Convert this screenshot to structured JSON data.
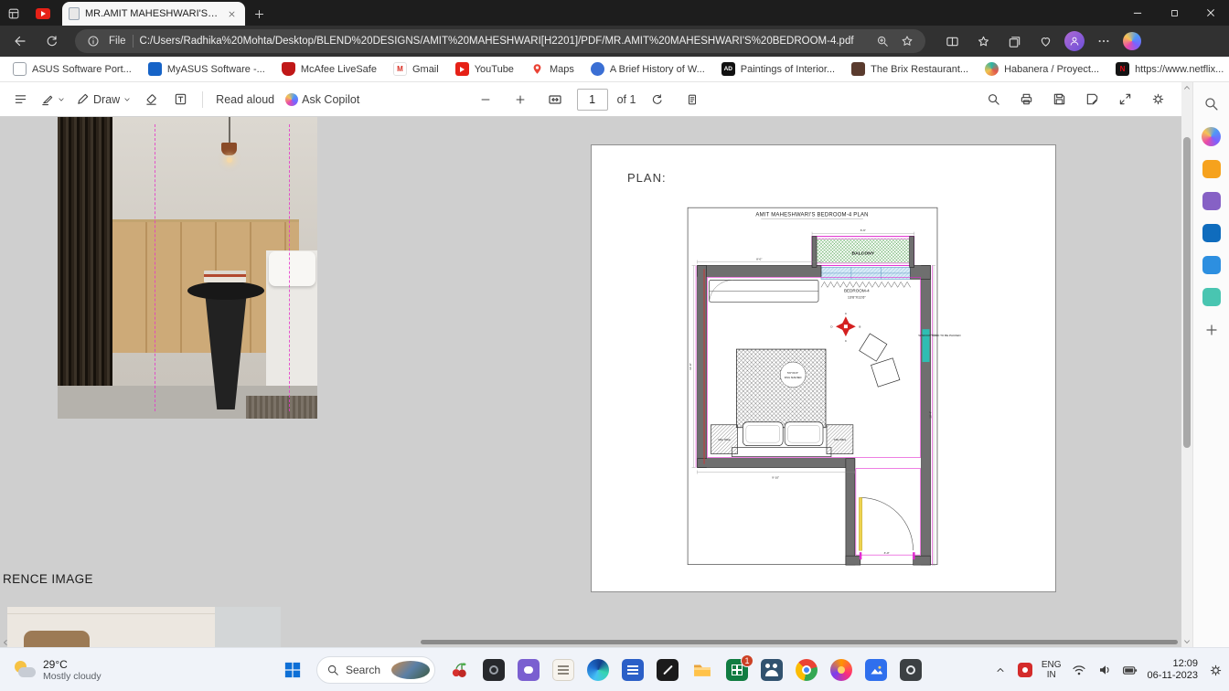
{
  "browser": {
    "tab_title": "MR.AMIT MAHESHWARI'S BEDR...",
    "file_label": "File",
    "url": "C:/Users/Radhika%20Mohta/Desktop/BLEND%20DESIGNS/AMIT%20MAHESHWARI[H2201]/PDF/MR.AMIT%20MAHESHWARI'S%20BEDROOM-4.pdf",
    "bookmarks": [
      {
        "label": "ASUS Software Port..."
      },
      {
        "label": "MyASUS Software -..."
      },
      {
        "label": "McAfee LiveSafe"
      },
      {
        "label": "Gmail",
        "glyph": "M"
      },
      {
        "label": "YouTube"
      },
      {
        "label": "Maps"
      },
      {
        "label": "A Brief History of W..."
      },
      {
        "label": "Paintings of Interior...",
        "glyph": "AD"
      },
      {
        "label": "The Brix Restaurant..."
      },
      {
        "label": "Habanera / Proyect..."
      },
      {
        "label": "https://www.netflix...",
        "glyph": "N"
      }
    ]
  },
  "pdf_toolbar": {
    "draw_label": "Draw",
    "read_aloud_label": "Read aloud",
    "ask_copilot_label": "Ask Copilot",
    "page_value": "1",
    "page_total_label": "of 1"
  },
  "document": {
    "reference_caption": "RENCE IMAGE",
    "plan_heading": "PLAN:",
    "plan": {
      "title": "AMIT MAHESHWARI'S BEDROOM-4 PLAN",
      "balcony_label": "BALCONY",
      "room_name": "BEDROOM-4",
      "room_size": "13'6\"X11'6\"",
      "bed_size": "5'0\"X6'3\"",
      "bed_label": "KING SIZE BED",
      "window_note": "WINDOW NEED TO BE PACKED",
      "side_table_left": "SIDE TABLE",
      "side_table_right": "SIDE TABLE",
      "elevation_markers": {
        "top": "A",
        "right": "B",
        "bottom": "C",
        "left": "D"
      },
      "dimensions": {
        "top_wall": "8'-0\"",
        "balcony": "6'-6\"",
        "left": "11'-6\"",
        "bottom": "9'-10\"",
        "right": "19'-4\"",
        "door": "3'-0\""
      },
      "colors": {
        "wall_fill": "#6f6f6f",
        "finish_magenta": "#e22ad0",
        "window_teal": "#2fbdb3",
        "door_yellow": "#eed34f",
        "marker_red": "#d42020",
        "balcony_green": "#3f9b3f"
      }
    }
  },
  "taskbar": {
    "weather_temp": "29°C",
    "weather_desc": "Mostly cloudy",
    "search_label": "Search",
    "excel_badge": "1",
    "language": "ENG",
    "region": "IN",
    "time": "12:09",
    "date": "06-11-2023"
  }
}
